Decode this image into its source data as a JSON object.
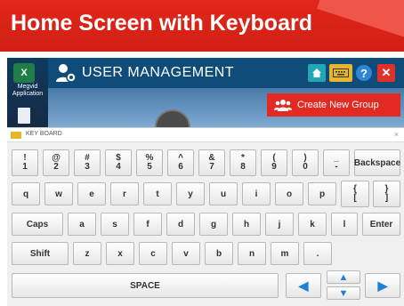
{
  "banner": {
    "title": "Home Screen with Keyboard"
  },
  "desktop": {
    "excel_label": "Megvid Application",
    "excel_letter": "X"
  },
  "app": {
    "title": "USER MANAGEMENT",
    "create_group_label": "Create New Group",
    "help_glyph": "?",
    "close_glyph": "✕"
  },
  "keyboard": {
    "window_title": "KEY BOARD",
    "close_glyph": "×",
    "row1": [
      {
        "top": "!",
        "bottom": "1"
      },
      {
        "top": "@",
        "bottom": "2"
      },
      {
        "top": "#",
        "bottom": "3"
      },
      {
        "top": "$",
        "bottom": "4"
      },
      {
        "top": "%",
        "bottom": "5"
      },
      {
        "top": "^",
        "bottom": "6"
      },
      {
        "top": "&",
        "bottom": "7"
      },
      {
        "top": "*",
        "bottom": "8"
      },
      {
        "top": "(",
        "bottom": "9"
      },
      {
        "top": ")",
        "bottom": "0"
      },
      {
        "top": "_",
        "bottom": "-"
      }
    ],
    "backspace": "Backspace",
    "row2": [
      "q",
      "w",
      "e",
      "r",
      "t",
      "y",
      "u",
      "i",
      "o",
      "p"
    ],
    "brace_open": {
      "top": "{",
      "bottom": "["
    },
    "brace_close": {
      "top": "}",
      "bottom": "]"
    },
    "caps": "Caps",
    "row3": [
      "a",
      "s",
      "f",
      "d",
      "g",
      "h",
      "j",
      "k",
      "l"
    ],
    "enter": "Enter",
    "shift": "Shift",
    "row4": [
      "z",
      "x",
      "c",
      "v",
      "b",
      "n",
      "m",
      "."
    ],
    "space": "SPACE",
    "arrow_left": "◀",
    "arrow_up": "▲",
    "arrow_down": "▼",
    "arrow_right": "▶"
  },
  "colors": {
    "banner": "#d11f14",
    "app_header": "#0f4c7a",
    "create_group": "#e32a22",
    "arrow": "#1e7fd6"
  }
}
